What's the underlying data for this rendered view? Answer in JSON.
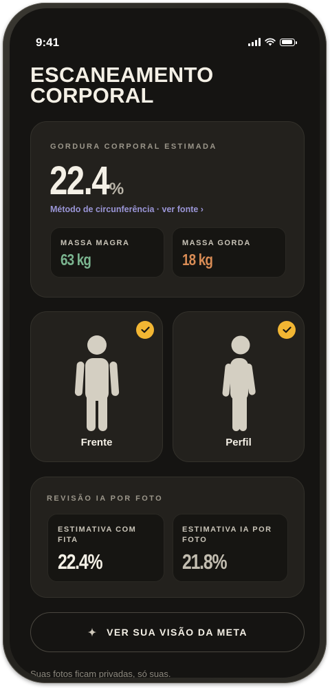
{
  "status_bar": {
    "time": "9:41"
  },
  "title": {
    "line1": "ESCANEAMENTO",
    "line2": "CORPORAL"
  },
  "body_fat": {
    "label": "GORDURA CORPORAL ESTIMADA",
    "value": "22.4",
    "unit": "%",
    "method_link": "Método de circunferência · ver fonte ›",
    "lean_mass": {
      "label": "MASSA MAGRA",
      "value": "63 kg",
      "color": "#7bb590"
    },
    "fat_mass": {
      "label": "MASSA GORDA",
      "value": "18 kg",
      "color": "#d98c55"
    }
  },
  "photos": [
    {
      "label": "Frente",
      "checked": true,
      "icon": "front-body-icon"
    },
    {
      "label": "Perfil",
      "checked": true,
      "icon": "side-body-icon"
    }
  ],
  "ai_review": {
    "label": "REVISÃO IA POR FOTO",
    "tape": {
      "label_line1": "ESTIMATIVA COM",
      "label_line2": "FITA",
      "value": "22.4%"
    },
    "ai": {
      "label_line1": "ESTIMATIVA IA POR",
      "label_line2": "FOTO",
      "value": "21.8%"
    }
  },
  "cta": {
    "label": "VER SUA VISÃO DA META",
    "icon": "sparkle-icon"
  },
  "footer": {
    "text": "Suas fotos ficam privadas, só suas."
  },
  "colors": {
    "accent": "#f2b633",
    "background": "#151412",
    "card": "#23211d",
    "link": "#9a95d6"
  }
}
